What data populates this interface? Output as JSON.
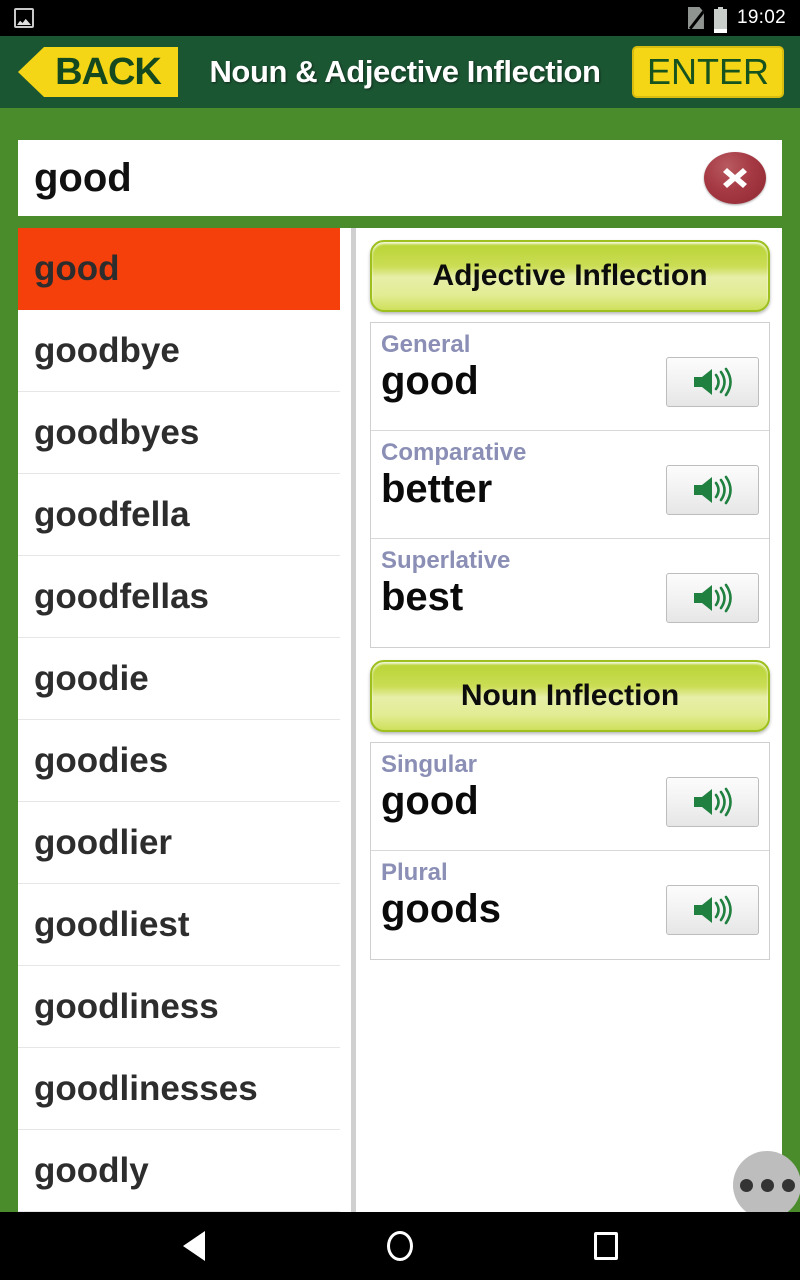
{
  "statusbar": {
    "notification_icon": "image-icon",
    "sim_icon": "no-sim-icon",
    "battery_icon": "battery-icon",
    "time": "19:02"
  },
  "titlebar": {
    "back_label": "BACK",
    "title": "Noun & Adjective Inflection",
    "enter_label": "ENTER",
    "bar_color": "#1b5633",
    "button_color": "#f5d616"
  },
  "search": {
    "value": "good",
    "placeholder": "",
    "clear_icon": "clear-x-icon"
  },
  "wordlist": {
    "selected_index": 0,
    "selected_color": "#f6400c",
    "items": [
      {
        "word": "good"
      },
      {
        "word": "goodbye"
      },
      {
        "word": "goodbyes"
      },
      {
        "word": "goodfella"
      },
      {
        "word": "goodfellas"
      },
      {
        "word": "goodie"
      },
      {
        "word": "goodies"
      },
      {
        "word": "goodlier"
      },
      {
        "word": "goodliest"
      },
      {
        "word": "goodliness"
      },
      {
        "word": "goodlinesses"
      },
      {
        "word": "goodly"
      }
    ]
  },
  "detail": {
    "sections": [
      {
        "header": "Adjective Inflection",
        "rows": [
          {
            "label": "General",
            "value": "good",
            "speak_icon": "speaker-icon"
          },
          {
            "label": "Comparative",
            "value": "better",
            "speak_icon": "speaker-icon"
          },
          {
            "label": "Superlative",
            "value": "best",
            "speak_icon": "speaker-icon"
          }
        ]
      },
      {
        "header": "Noun Inflection",
        "rows": [
          {
            "label": "Singular",
            "value": "good",
            "speak_icon": "speaker-icon"
          },
          {
            "label": "Plural",
            "value": "goods",
            "speak_icon": "speaker-icon"
          }
        ]
      }
    ]
  },
  "fab": {
    "icon": "more-options-icon"
  },
  "navbar": {
    "back_icon": "nav-back-icon",
    "home_icon": "nav-home-icon",
    "recents_icon": "nav-recents-icon"
  }
}
